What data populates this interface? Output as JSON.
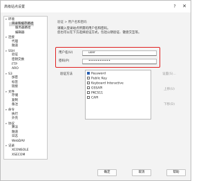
{
  "window": {
    "title": "高级站点设置",
    "help_glyph": "?",
    "close_glyph": "✕"
  },
  "tree": {
    "items": [
      {
        "label": "环境",
        "twisty": "▾"
      },
      {
        "label": "目录和缓存路径",
        "twisty": ""
      },
      {
        "label": "服务器路径",
        "twisty": ""
      },
      {
        "label": "编辑器",
        "twisty": ""
      },
      {
        "label": "连接",
        "twisty": "▾"
      },
      {
        "label": "代理",
        "twisty": ""
      },
      {
        "label": "隧道",
        "twisty": ""
      },
      {
        "label": "SSH",
        "twisty": "▾"
      },
      {
        "label": "验证",
        "twisty": ""
      },
      {
        "label": "密钥交换",
        "twisty": ""
      },
      {
        "label": "FTP",
        "twisty": ""
      },
      {
        "label": "ARO",
        "twisty": ""
      },
      {
        "label": "S3",
        "twisty": "▾"
      },
      {
        "label": "加密",
        "twisty": ""
      },
      {
        "label": "标签",
        "twisty": ""
      },
      {
        "label": "链接",
        "twisty": ""
      },
      {
        "label": "文件",
        "twisty": "▾"
      },
      {
        "label": "存储",
        "twisty": ""
      },
      {
        "label": "复制",
        "twisty": ""
      },
      {
        "label": "备注",
        "twisty": ""
      },
      {
        "label": "命令",
        "twisty": "▾"
      },
      {
        "label": "执行",
        "twisty": ""
      },
      {
        "label": "外壳",
        "twisty": ""
      },
      {
        "label": "协议",
        "twisty": "▾"
      },
      {
        "label": "算法",
        "twisty": ""
      },
      {
        "label": "隧道",
        "twisty": ""
      },
      {
        "label": "日志",
        "twisty": ""
      },
      {
        "label": "WebDAV",
        "twisty": ""
      },
      {
        "label": "记录",
        "twisty": "▾"
      },
      {
        "label": "XCONSOLE",
        "twisty": ""
      },
      {
        "label": "XSECOM",
        "twisty": ""
      }
    ]
  },
  "panel": {
    "breadcrumb": "验证 > 用户名和密码",
    "desc_line1": "请输入登录站点所需的用户名和密码。",
    "desc_line2": "您也可以在下方选择验证方式，包括公钥验证、键盘交互等。",
    "username_label": "用户名(U)",
    "username_value": "user",
    "password_label": "密码(P)",
    "password_value": "••••••••••••",
    "methods_label": "验证方法",
    "methods": [
      {
        "label": "Password",
        "checked": true
      },
      {
        "label": "Public Key",
        "checked": false
      },
      {
        "label": "Keyboard Interactive",
        "checked": false
      },
      {
        "label": "GSSAPI",
        "checked": false
      },
      {
        "label": "PKCS11",
        "checked": false
      },
      {
        "label": "CAPI",
        "checked": false
      }
    ],
    "side_buttons": [
      "设置(S)...",
      "上移(U)",
      "下移(D)"
    ]
  },
  "footer": {
    "ok_label": "确定",
    "cancel_label": "取消",
    "help_label": "帮助"
  }
}
